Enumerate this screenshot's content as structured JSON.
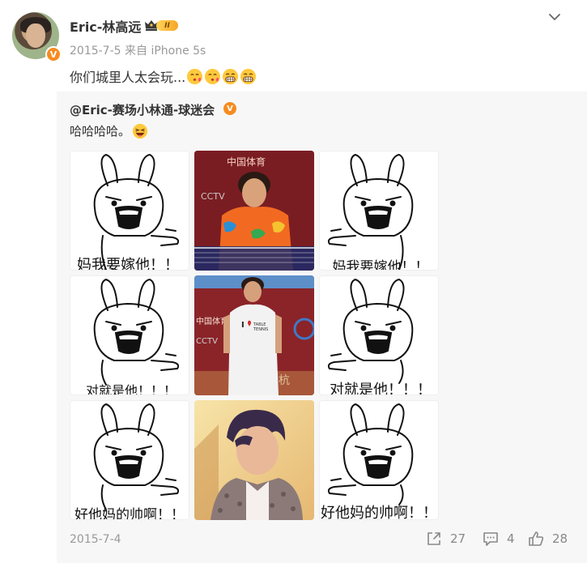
{
  "post": {
    "username": "Eric-林高远",
    "level": "II",
    "meta": "2015-7-5 来自 iPhone 5s",
    "text": "你们城里人太会玩...",
    "emojis": [
      "kiss-face-emoji",
      "kiss-face-emoji",
      "grin-face-emoji",
      "grin-face-emoji"
    ]
  },
  "repost": {
    "username": "@Eric-赛场小林通-球迷会",
    "text": "哈哈哈哈。",
    "date": "2015-7-4",
    "captions": [
      "妈我要嫁他！！",
      "妈我要嫁他！！",
      "对就是他！！！",
      "对就是他！！！",
      "好他妈的帅啊！！",
      "好他妈的帅啊！！"
    ],
    "actions": {
      "repost_count": "27",
      "comment_count": "4",
      "like_count": "28"
    }
  },
  "colors": {
    "accent": "#f78b1f",
    "muted": "#999999",
    "repost_bg": "#f7f7f8"
  }
}
